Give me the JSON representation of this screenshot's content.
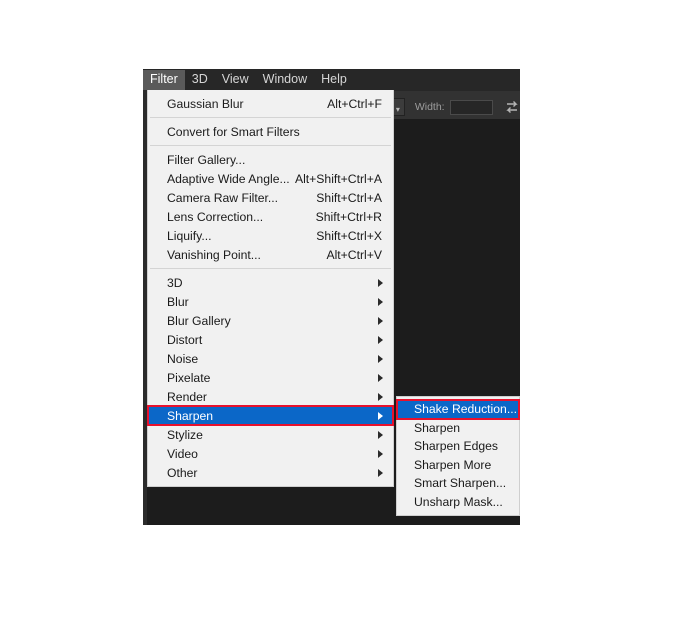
{
  "app": {
    "backdrop_color": "#1c1c1c",
    "panel_color": "#323232"
  },
  "menubar": {
    "items": [
      {
        "label": "Filter",
        "active": true
      },
      {
        "label": "3D",
        "active": false
      },
      {
        "label": "View",
        "active": false
      },
      {
        "label": "Window",
        "active": false
      },
      {
        "label": "Help",
        "active": false
      }
    ]
  },
  "options_bar": {
    "width_label": "Width:",
    "width_value": "",
    "width_placeholder": "",
    "swap_icon": "swap-arrows-icon",
    "chevron_icon": "chevron-down-icon"
  },
  "filter_menu": {
    "groups": [
      {
        "items": [
          {
            "label": "Gaussian Blur",
            "shortcut": "Alt+Ctrl+F",
            "has_submenu": false,
            "selected": false
          }
        ]
      },
      {
        "items": [
          {
            "label": "Convert for Smart Filters",
            "shortcut": "",
            "has_submenu": false,
            "selected": false
          }
        ]
      },
      {
        "items": [
          {
            "label": "Filter Gallery...",
            "shortcut": "",
            "has_submenu": false,
            "selected": false
          },
          {
            "label": "Adaptive Wide Angle...",
            "shortcut": "Alt+Shift+Ctrl+A",
            "has_submenu": false,
            "selected": false
          },
          {
            "label": "Camera Raw Filter...",
            "shortcut": "Shift+Ctrl+A",
            "has_submenu": false,
            "selected": false
          },
          {
            "label": "Lens Correction...",
            "shortcut": "Shift+Ctrl+R",
            "has_submenu": false,
            "selected": false
          },
          {
            "label": "Liquify...",
            "shortcut": "Shift+Ctrl+X",
            "has_submenu": false,
            "selected": false
          },
          {
            "label": "Vanishing Point...",
            "shortcut": "Alt+Ctrl+V",
            "has_submenu": false,
            "selected": false
          }
        ]
      },
      {
        "items": [
          {
            "label": "3D",
            "shortcut": "",
            "has_submenu": true,
            "selected": false
          },
          {
            "label": "Blur",
            "shortcut": "",
            "has_submenu": true,
            "selected": false
          },
          {
            "label": "Blur Gallery",
            "shortcut": "",
            "has_submenu": true,
            "selected": false
          },
          {
            "label": "Distort",
            "shortcut": "",
            "has_submenu": true,
            "selected": false
          },
          {
            "label": "Noise",
            "shortcut": "",
            "has_submenu": true,
            "selected": false
          },
          {
            "label": "Pixelate",
            "shortcut": "",
            "has_submenu": true,
            "selected": false
          },
          {
            "label": "Render",
            "shortcut": "",
            "has_submenu": true,
            "selected": false
          },
          {
            "label": "Sharpen",
            "shortcut": "",
            "has_submenu": true,
            "selected": true
          },
          {
            "label": "Stylize",
            "shortcut": "",
            "has_submenu": true,
            "selected": false
          },
          {
            "label": "Video",
            "shortcut": "",
            "has_submenu": true,
            "selected": false
          },
          {
            "label": "Other",
            "shortcut": "",
            "has_submenu": true,
            "selected": false
          }
        ]
      }
    ]
  },
  "sharpen_submenu": {
    "items": [
      {
        "label": "Shake Reduction...",
        "selected": true
      },
      {
        "label": "Sharpen",
        "selected": false
      },
      {
        "label": "Sharpen Edges",
        "selected": false
      },
      {
        "label": "Sharpen More",
        "selected": false
      },
      {
        "label": "Smart Sharpen...",
        "selected": false
      },
      {
        "label": "Unsharp Mask...",
        "selected": false
      }
    ]
  },
  "annotations": {
    "highlight_color": "#e8112d",
    "selection_color": "#0b67c8"
  }
}
